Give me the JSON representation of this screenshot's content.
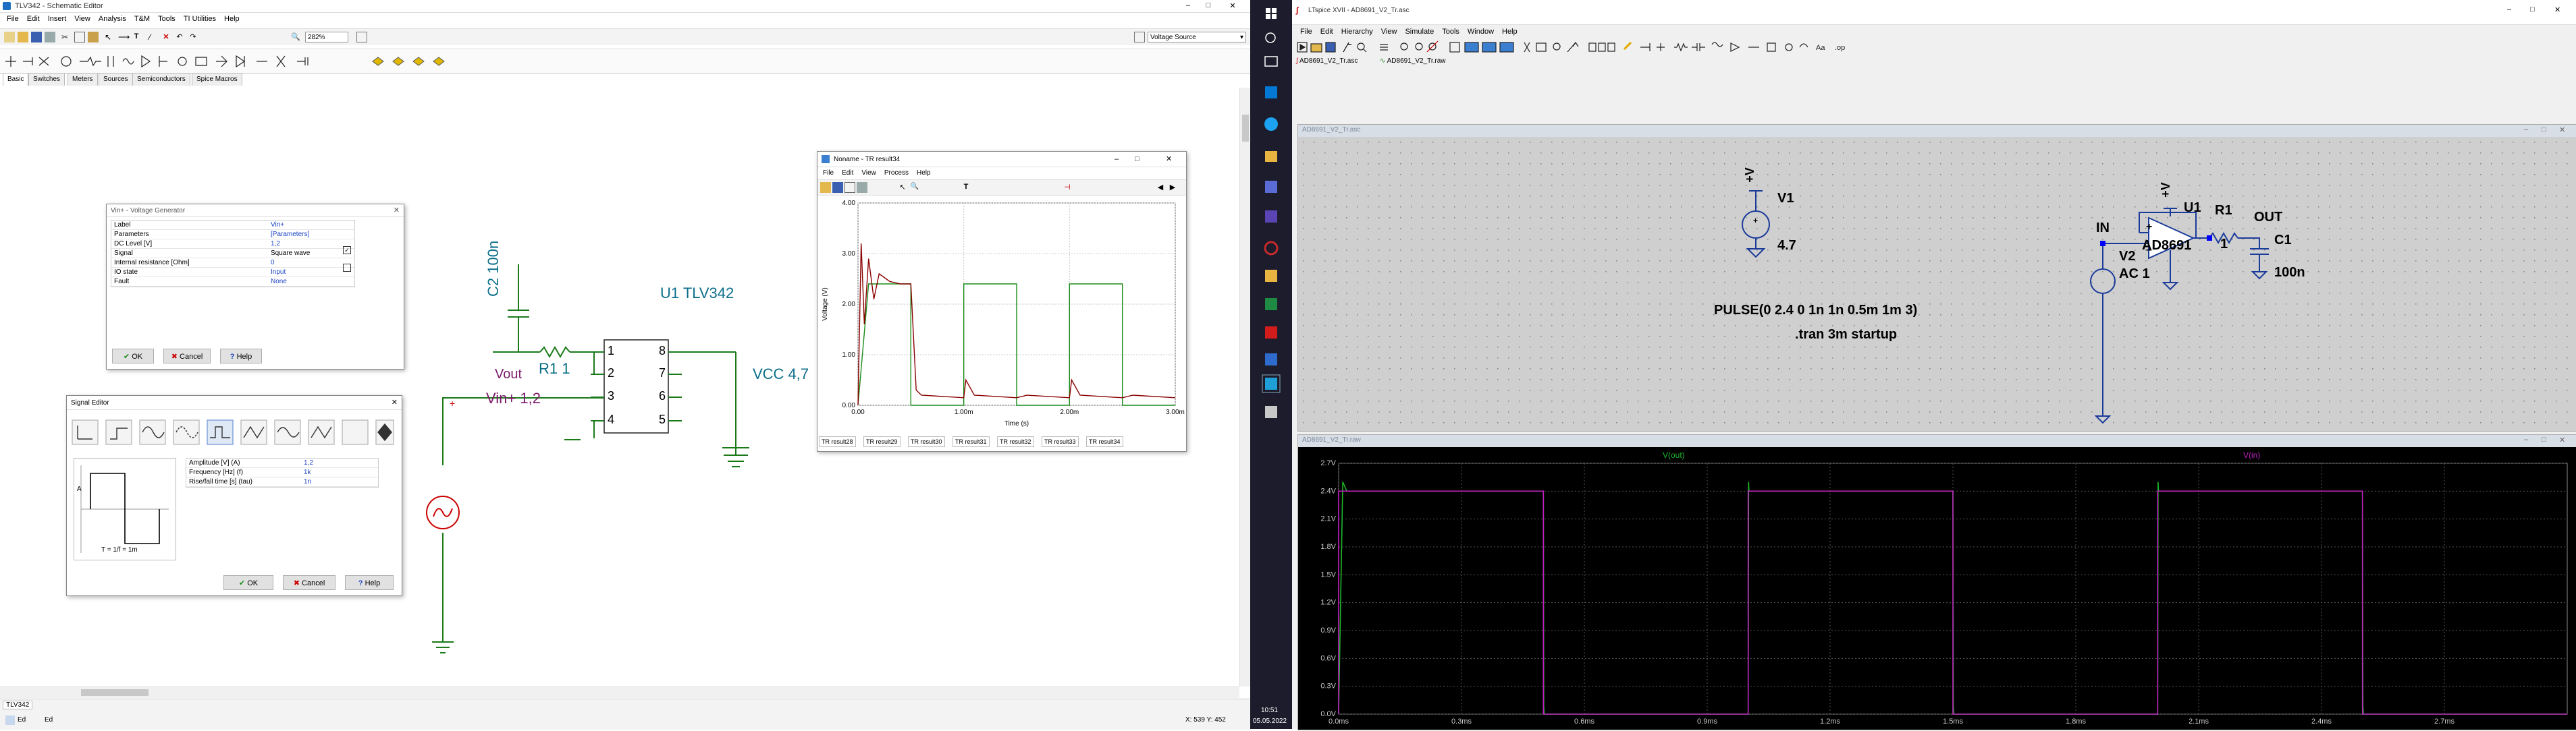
{
  "tina": {
    "title": "TLV342 - Schematic Editor",
    "menu": [
      "File",
      "Edit",
      "Insert",
      "View",
      "Analysis",
      "T&M",
      "Tools",
      "TI Utilities",
      "Help"
    ],
    "zoom": "282%",
    "component_select": "Voltage Source",
    "tabs": [
      "Basic",
      "Switches",
      "Meters",
      "Sources",
      "Semiconductors",
      "Spice Macros"
    ],
    "status_left": "TLV342",
    "status_bottom": [
      "Ed",
      "Ed"
    ],
    "coords": "X: 539  Y: 452",
    "schematic": {
      "u1_label": "U1 TLV342",
      "c2_label": "C2 100n",
      "r1_label": "R1 1",
      "vout_label": "Vout",
      "vin_label": "Vin+ 1,2",
      "vcc_label": "VCC 4,7",
      "pins": [
        "1",
        "2",
        "3",
        "4",
        "8",
        "7",
        "6",
        "5"
      ],
      "pin_plus": "+"
    }
  },
  "vgen": {
    "title": "Vin+ - Voltage Generator",
    "rows": [
      {
        "k": "Label",
        "v": "Vin+"
      },
      {
        "k": "Parameters",
        "v": "[Parameters]"
      },
      {
        "k": "DC Level [V]",
        "v": "1,2"
      },
      {
        "k": "Signal",
        "v": "Square wave"
      },
      {
        "k": "Internal resistance [Ohm]",
        "v": "0"
      },
      {
        "k": "IO state",
        "v": "Input"
      },
      {
        "k": "Fault",
        "v": "None"
      }
    ],
    "ok": "OK",
    "cancel": "Cancel",
    "help": "Help"
  },
  "sigedit": {
    "title": "Signal Editor",
    "rows": [
      {
        "k": "Amplitude [V] (A)",
        "v": "1,2"
      },
      {
        "k": "Frequency [Hz] (f)",
        "v": "1k"
      },
      {
        "k": "Rise/fall time [s] (tau)",
        "v": "1n"
      }
    ],
    "preview_a": "A",
    "preview_t": "T = 1/f = 1m",
    "ok": "OK",
    "cancel": "Cancel",
    "help": "Help"
  },
  "tr": {
    "title": "Noname - TR result34",
    "menu": [
      "File",
      "Edit",
      "View",
      "Process",
      "Help"
    ],
    "ylabel": "Voltage (V)",
    "xlabel": "Time (s)",
    "tabs": [
      "TR result28",
      "TR result29",
      "TR result30",
      "TR result31",
      "TR result32",
      "TR result33",
      "TR result34"
    ]
  },
  "taskbar": {
    "time": "10:51",
    "date": "05.05.2022"
  },
  "lt": {
    "title": "LTspice XVII - AD8691_V2_Tr.asc",
    "menu": [
      "File",
      "Edit",
      "Hierarchy",
      "View",
      "Simulate",
      "Tools",
      "Window",
      "Help"
    ],
    "doc_tabs": [
      "AD8691_V2_Tr.asc",
      "AD8691_V2_Tr.raw"
    ],
    "sch_title": "AD8691_V2_Tr.asc",
    "plot_title": "AD8691_V2_Tr.raw",
    "schematic": {
      "v1": "V1",
      "v1_val": "4.7",
      "v_plus": "+V",
      "u1": "U1",
      "part": "AD8691",
      "in": "IN",
      "out": "OUT",
      "r1": "R1",
      "r1_val": "1",
      "c1": "C1",
      "c1_val": "100n",
      "v2": "V2",
      "v2_val": "AC 1",
      "pulse": "PULSE(0 2.4 0 1n 1n 0.5m 1m 3)",
      "tran": ".tran 3m startup"
    }
  },
  "chart_data": [
    {
      "type": "line",
      "title": "",
      "xlabel": "Time (s)",
      "ylabel": "Voltage (V)",
      "xlim": [
        0,
        0.003
      ],
      "ylim": [
        0,
        4
      ],
      "x_ticks": [
        "0.00",
        "1.00m",
        "2.00m",
        "3.00m"
      ],
      "y_ticks": [
        "0.00",
        "1.00",
        "2.00",
        "3.00",
        "4.00"
      ],
      "grid": true,
      "series": [
        {
          "name": "",
          "color": "#1a8c1a",
          "x": [
            0,
            0.0001,
            0.0005,
            0.0005,
            0.001,
            0.001,
            0.0015,
            0.0015,
            0.002,
            0.002,
            0.0025,
            0.0025,
            0.003
          ],
          "values": [
            0,
            2.4,
            2.4,
            0,
            0,
            2.4,
            2.4,
            0,
            0,
            2.4,
            2.4,
            0,
            0
          ]
        },
        {
          "name": "",
          "color": "#8b0000",
          "x": [
            0,
            3e-05,
            6e-05,
            0.0001,
            0.00015,
            0.0002,
            0.0003,
            0.0004,
            0.0005,
            0.00055,
            0.0006,
            0.001,
            0.00102,
            0.0011,
            0.0015,
            0.0016,
            0.002,
            0.00202,
            0.0021,
            0.0025,
            0.0026,
            0.003
          ],
          "values": [
            0,
            3.2,
            1.6,
            2.9,
            2.1,
            2.6,
            2.45,
            2.4,
            2.4,
            0.3,
            0.2,
            0.15,
            0.5,
            0.2,
            0.15,
            0.2,
            0.15,
            0.5,
            0.2,
            0.15,
            0.2,
            0.15
          ]
        }
      ]
    },
    {
      "type": "line",
      "title": "",
      "xlabel": "",
      "ylabel": "",
      "xlim": [
        0,
        0.003
      ],
      "ylim": [
        0,
        2.7
      ],
      "x_ticks": [
        "0.0ms",
        "0.3ms",
        "0.6ms",
        "0.9ms",
        "1.2ms",
        "1.5ms",
        "1.8ms",
        "2.1ms",
        "2.4ms",
        "2.7ms"
      ],
      "y_ticks": [
        "0.0V",
        "0.3V",
        "0.6V",
        "0.9V",
        "1.2V",
        "1.5V",
        "1.8V",
        "2.1V",
        "2.4V",
        "2.7V"
      ],
      "grid": true,
      "legend": [
        "V(out)",
        "V(in)"
      ],
      "series": [
        {
          "name": "V(out)",
          "color": "#1fb52a",
          "x": [
            0,
            1e-05,
            2e-05,
            0.0005,
            0.000501,
            0.000502,
            0.001,
            0.001001,
            0.001002,
            0.0015,
            0.001501,
            0.001502,
            0.002,
            0.002001,
            0.002002,
            0.0025,
            0.002501,
            0.002502,
            0.003
          ],
          "values": [
            0,
            2.5,
            2.4,
            2.4,
            0.1,
            0,
            0,
            2.5,
            2.4,
            2.4,
            0.1,
            0,
            0,
            2.5,
            2.4,
            2.4,
            0.1,
            0,
            0
          ]
        },
        {
          "name": "V(in)",
          "color": "#c020c0",
          "x": [
            0,
            0,
            0.0005,
            0.0005,
            0.001,
            0.001,
            0.0015,
            0.0015,
            0.002,
            0.002,
            0.0025,
            0.0025,
            0.003
          ],
          "values": [
            0,
            2.4,
            2.4,
            0,
            0,
            2.4,
            2.4,
            0,
            0,
            2.4,
            2.4,
            0,
            0
          ]
        }
      ]
    }
  ]
}
